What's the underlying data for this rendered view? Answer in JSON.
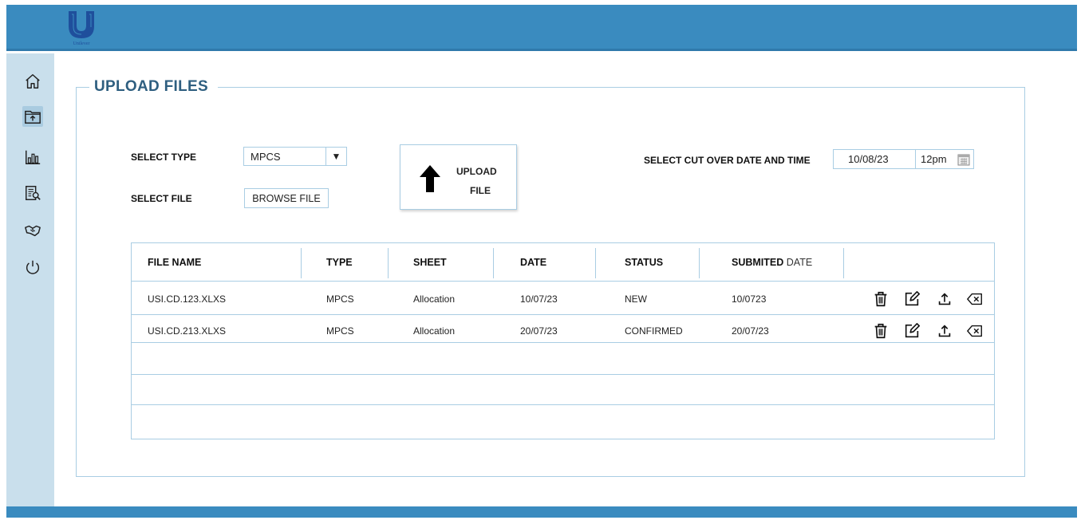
{
  "colors": {
    "header": "#3a8bbf",
    "sidebar": "#c9dfec",
    "border": "#a9cde3",
    "title": "#2f5f80"
  },
  "brand": {
    "logo_text": "Unilever"
  },
  "sidebar": {
    "items": [
      {
        "icon": "home-icon"
      },
      {
        "icon": "upload-folder-icon"
      },
      {
        "icon": "bar-chart-icon"
      },
      {
        "icon": "report-search-icon"
      },
      {
        "icon": "handshake-icon"
      },
      {
        "icon": "power-icon"
      }
    ]
  },
  "panel": {
    "title": "UPLOAD FILES"
  },
  "form": {
    "select_type_label": "SELECT TYPE",
    "select_type_value": "MPCS",
    "select_file_label": "SELECT FILE",
    "browse_label": "BROWSE FILE",
    "upload_line1": "UPLOAD",
    "upload_line2": "FILE",
    "cutover_label": "SELECT CUT OVER DATE AND TIME",
    "cutover_date": "10/08/23",
    "cutover_time": "12pm"
  },
  "table": {
    "headers": {
      "file_name": "FILE NAME",
      "type": "TYPE",
      "sheet": "SHEET",
      "date": "DATE",
      "status": "STATUS",
      "submitted_a": "SUBMITED",
      "submitted_b": "DATE"
    },
    "rows": [
      {
        "file_name": "USI.CD.123.XLXS",
        "type": "MPCS",
        "sheet": "Allocation",
        "date": "10/07/23",
        "status": "NEW",
        "submitted": "10/0723"
      },
      {
        "file_name": "USI.CD.213.XLXS",
        "type": "MPCS",
        "sheet": "Allocation",
        "date": "20/07/23",
        "status": "CONFIRMED",
        "submitted": "20/07/23"
      }
    ]
  }
}
